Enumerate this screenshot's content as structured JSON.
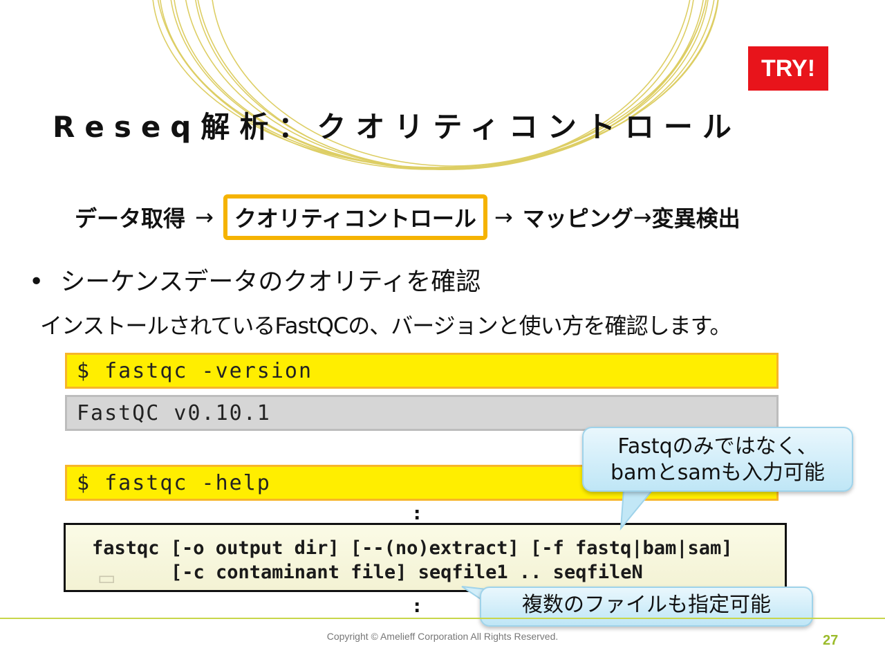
{
  "badge": "TRY!",
  "title": "Reseq解析：クオリティコントロール",
  "flow": {
    "step1": "データ取得",
    "arrow1": "→",
    "step2": "クオリティコントロール",
    "arrow2": "→",
    "step3": "マッピング",
    "arrow3": "→",
    "step4": "変異検出"
  },
  "bullet": "シーケンスデータのクオリティを確認",
  "intro": "インストールされているFastQCの、バージョンと使い方を確認します。",
  "code": {
    "cmd_version": "$ fastqc -version",
    "out_version": "FastQC v0.10.1",
    "cmd_help": "$ fastqc -help",
    "ellipsis": ":",
    "usage_line1": "fastqc [-o output dir] [--(no)extract] [-f fastq|bam|sam]",
    "usage_line2": "[-c contaminant file] seqfile1 .. seqfileN"
  },
  "callouts": {
    "formats_line1": "Fastqのみではなく、",
    "formats_line2": "bamとsamも入力可能",
    "multi": "複数のファイルも指定可能"
  },
  "footer": {
    "copyright": "Copyright © Amelieff Corporation All Rights Reserved.",
    "page": "27"
  },
  "colors": {
    "badge": "#e8141b",
    "highlight_border": "#f5b301",
    "command_bg": "#ffee00",
    "output_bg": "#d6d6d6",
    "callout_bg": "#c8eaf8",
    "footer_line": "#c8d64a",
    "page_number": "#9bbb2c",
    "rings": "#d8c64a"
  }
}
